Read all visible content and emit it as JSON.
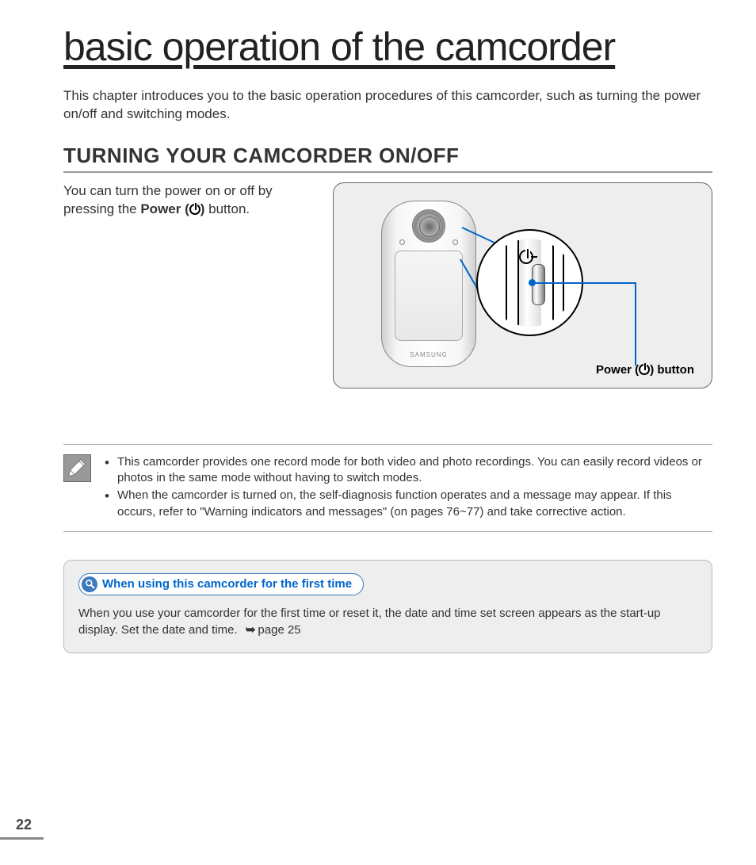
{
  "title": "basic operation of the camcorder",
  "intro": "This chapter introduces you to the basic operation procedures of this camcorder, such as turning the power on/off and switching modes.",
  "section": {
    "heading": "TURNING YOUR CAMCORDER ON/OFF",
    "body_before": "You can turn the power on or off by pressing the ",
    "power_label": "Power (",
    "power_label_after": ")",
    "body_after": " button.",
    "diagram_label_before": "Power (",
    "diagram_label_after": ") button",
    "device_logo": "SAMSUNG"
  },
  "notes": [
    "This camcorder provides one record mode for both video and photo recordings. You can easily record videos or photos in the same mode without having to switch modes.",
    "When the camcorder is turned on, the self-diagnosis function operates and a message may appear. If this occurs, refer to \"Warning indicators and messages\" (on pages 76~77) and take corrective action."
  ],
  "tip": {
    "header": "When using this camcorder for the first time",
    "body_before": "When you use your camcorder for the first time or reset it, the date and time set screen appears as the start-up display. Set the date and time. ",
    "page_ref": "page 25"
  },
  "page_number": "22"
}
